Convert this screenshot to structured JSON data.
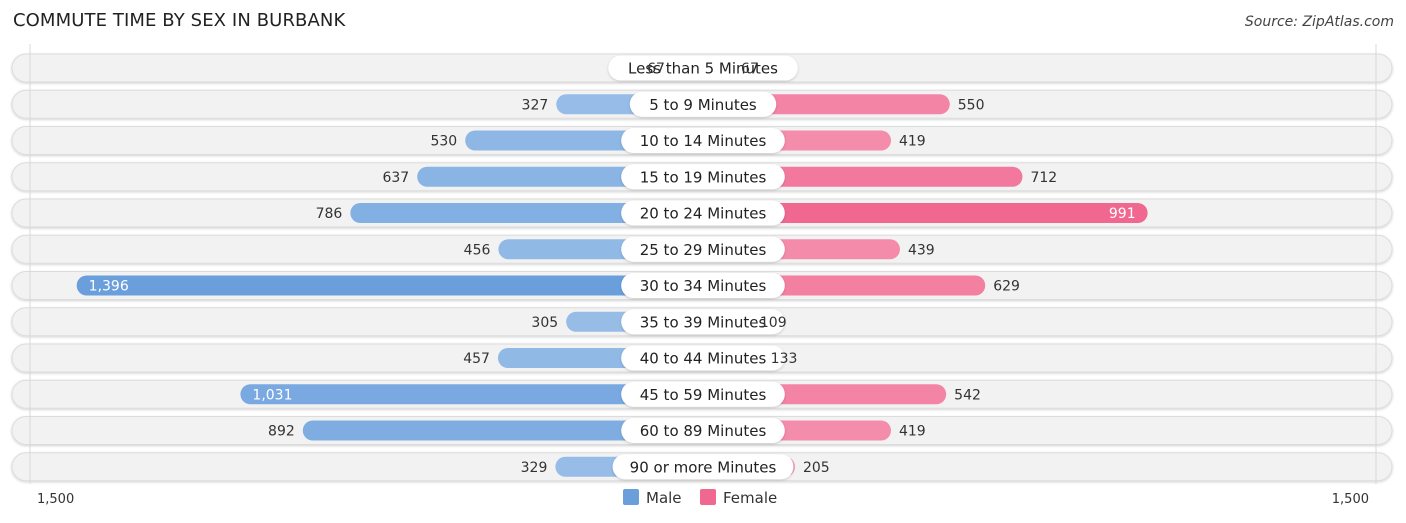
{
  "header": {
    "title": "COMMUTE TIME BY SEX IN BURBANK",
    "source": "Source: ZipAtlas.com"
  },
  "colors": {
    "male": "#6a9fdc",
    "male_light": "#a4c5ea",
    "female": "#f06890",
    "female_light": "#f7a6bf",
    "row_bg": "#f2f2f2",
    "row_border": "#dcdcdc"
  },
  "chart_data": {
    "type": "bar",
    "orientation": "horizontal-diverging",
    "title": "COMMUTE TIME BY SEX IN BURBANK",
    "categories": [
      "Less than 5 Minutes",
      "5 to 9 Minutes",
      "10 to 14 Minutes",
      "15 to 19 Minutes",
      "20 to 24 Minutes",
      "25 to 29 Minutes",
      "30 to 34 Minutes",
      "35 to 39 Minutes",
      "40 to 44 Minutes",
      "45 to 59 Minutes",
      "60 to 89 Minutes",
      "90 or more Minutes"
    ],
    "series": [
      {
        "name": "Male",
        "side": "left",
        "values": [
          67,
          327,
          530,
          637,
          786,
          456,
          1396,
          305,
          457,
          1031,
          892,
          329
        ],
        "labels": [
          "67",
          "327",
          "530",
          "637",
          "786",
          "456",
          "1,396",
          "305",
          "457",
          "1,031",
          "892",
          "329"
        ]
      },
      {
        "name": "Female",
        "side": "right",
        "values": [
          67,
          550,
          419,
          712,
          991,
          439,
          629,
          109,
          133,
          542,
          419,
          205
        ],
        "labels": [
          "67",
          "550",
          "419",
          "712",
          "991",
          "439",
          "629",
          "109",
          "133",
          "542",
          "419",
          "205"
        ]
      }
    ],
    "xlim": [
      1500,
      1500
    ],
    "axis_labels": {
      "left": "1,500",
      "right": "1,500"
    },
    "legend": {
      "position": "bottom-center",
      "entries": [
        "Male",
        "Female"
      ]
    },
    "xlabel": "",
    "ylabel": "",
    "grid": false
  }
}
